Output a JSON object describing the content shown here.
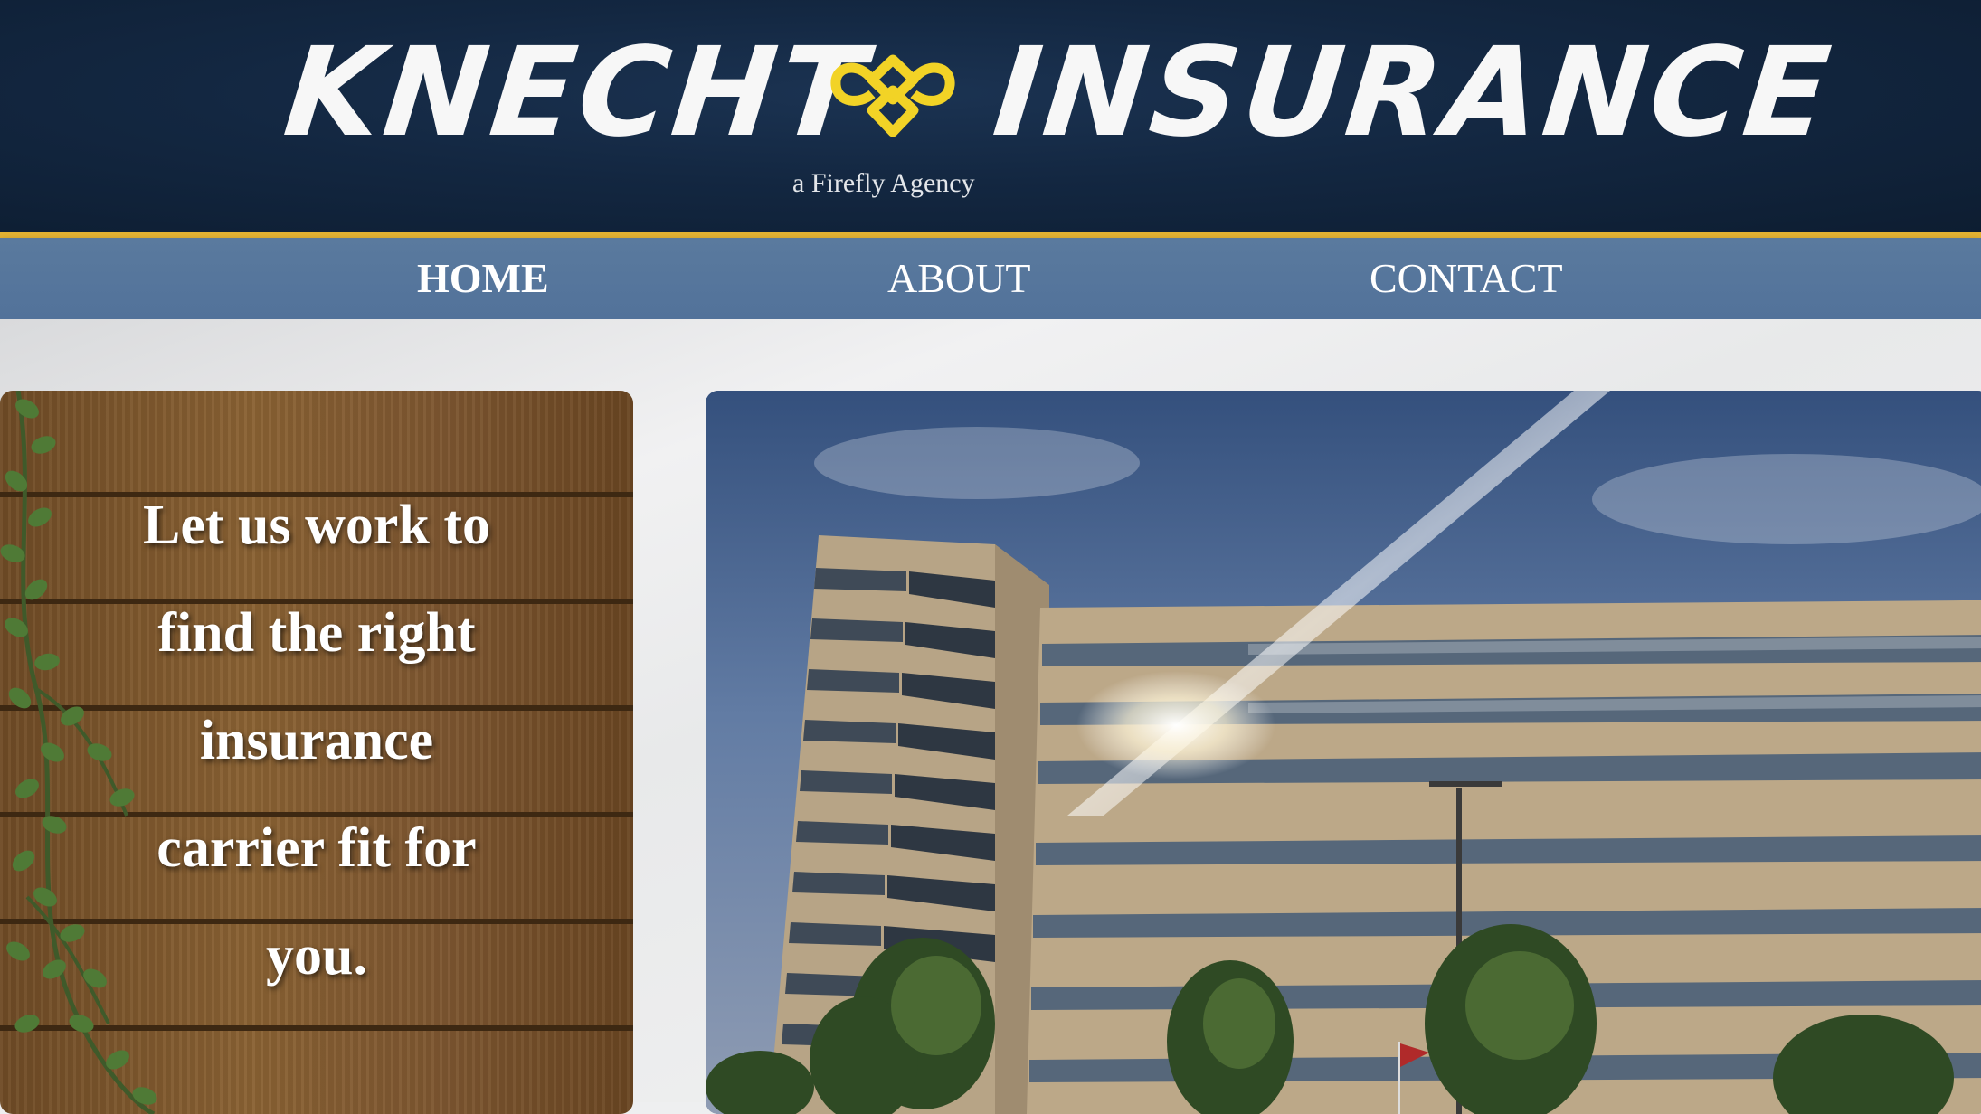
{
  "header": {
    "brand_left": "KNECHT",
    "brand_right": "INSURANCE",
    "logo_icon": "firefly-knot-logo",
    "tagline": "a Firefly Agency"
  },
  "nav": {
    "items": [
      {
        "label": "HOME",
        "active": true
      },
      {
        "label": "ABOUT",
        "active": false
      },
      {
        "label": "CONTACT",
        "active": false
      }
    ]
  },
  "promo": {
    "lines": [
      "Let us work to",
      "find the right",
      "insurance",
      "carrier fit for",
      "you."
    ]
  },
  "photo": {
    "subject": "office-building-photo"
  },
  "colors": {
    "header_bg": "#112540",
    "accent_gold": "#e3b233",
    "nav_bg": "#55759c",
    "text_white": "#ffffff"
  }
}
